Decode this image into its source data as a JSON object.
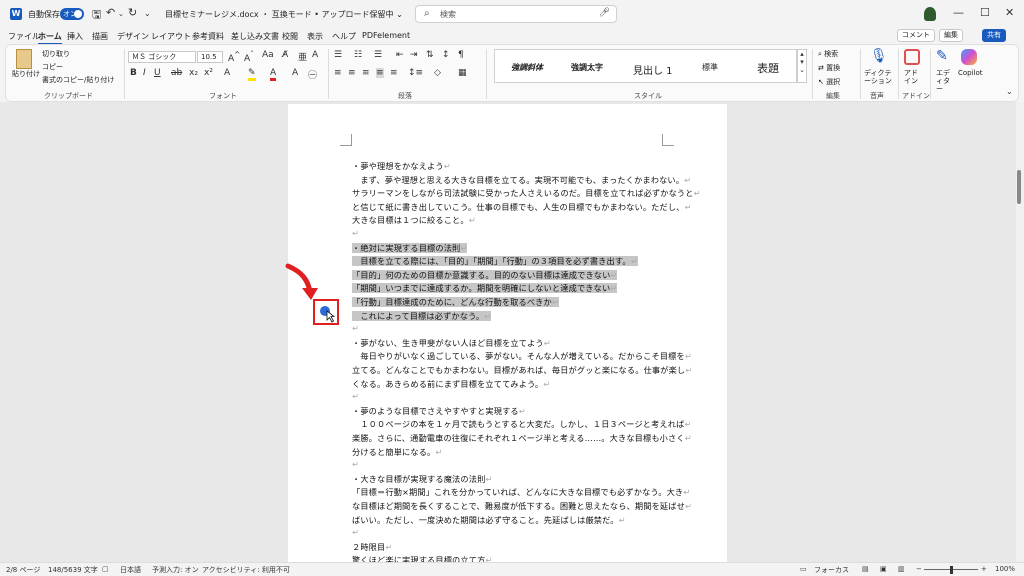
{
  "titlebar": {
    "autosave_label": "自動保存",
    "autosave_toggle": "オン",
    "doc_title": "目標セミナーレジメ.docx ・ 互換モード • アップロード保留中 ⌄",
    "search_placeholder": "検索"
  },
  "menu": [
    "ファイル",
    "ホーム",
    "挿入",
    "描画",
    "デザイン",
    "レイアウト",
    "参考資料",
    "差し込み文書",
    "校閲",
    "表示",
    "ヘルプ",
    "PDFelement"
  ],
  "topbuttons": {
    "comment": "コメント",
    "edit": "編集",
    "share": "共有"
  },
  "ribbon": {
    "clipboard": {
      "paste": "貼り付け",
      "cut": "切り取り",
      "copy": "コピー",
      "format_painter": "書式のコピー/貼り付け",
      "label": "クリップボード"
    },
    "font": {
      "name": "ＭＳ ゴシック",
      "size": "10.5",
      "label": "フォント"
    },
    "paragraph": {
      "label": "段落"
    },
    "styles": {
      "items": [
        "強調斜体",
        "強調太字",
        "見出し 1",
        "標準",
        "表題"
      ],
      "label": "スタイル"
    },
    "editing": {
      "search": "検索",
      "replace": "置換",
      "select": "選択",
      "label": "編集"
    },
    "voice": {
      "dictation": "ディクテーション",
      "label": "音声"
    },
    "addins": {
      "addin": "アドイン",
      "label": "アドイン"
    },
    "editor": "エディター",
    "copilot": "Copilot"
  },
  "document": {
    "lines": [
      {
        "t": "・夢や理想をかなえよう",
        "hl": false
      },
      {
        "t": "　まず、夢や理想と思える大きな目標を立てる。実現不可能でも、まったくかまわない。",
        "hl": false
      },
      {
        "t": "サラリーマンをしながら司法試験に受かった人さえいるのだ。目標を立てれば必ずかなうと",
        "hl": false
      },
      {
        "t": "と信じて紙に書き出していこう。仕事の目標でも、人生の目標でもかまわない。ただし、",
        "hl": false
      },
      {
        "t": "大きな目標は１つに絞ること。",
        "hl": false
      },
      {
        "t": "",
        "hl": false
      },
      {
        "t": "・絶対に実現する目標の法則",
        "hl": true
      },
      {
        "t": "　目標を立てる際には、「目的」「期間」「行動」の３項目を必ず書き出す。",
        "hl": true
      },
      {
        "t": "「目的」何のための目標か意識する。目的のない目標は達成できない",
        "hl": true
      },
      {
        "t": "「期間」いつまでに達成するか。期間を明確にしないと達成できない",
        "hl": true
      },
      {
        "t": "「行動」目標達成のために、どんな行動を取るべきか",
        "hl": true
      },
      {
        "t": "　これによって目標は必ずかなう。",
        "hl": true
      },
      {
        "t": "",
        "hl": false
      },
      {
        "t": "・夢がない、生き甲斐がない人ほど目標を立てよう",
        "hl": false
      },
      {
        "t": "　毎日やりがいなく過ごしている、夢がない。そんな人が増えている。だからこそ目標を",
        "hl": false
      },
      {
        "t": "立てる。どんなことでもかまわない。目標があれば、毎日がグッと楽になる。仕事が楽し",
        "hl": false
      },
      {
        "t": "くなる。あきらめる前にまず目標を立ててみよう。",
        "hl": false
      },
      {
        "t": "",
        "hl": false
      },
      {
        "t": "・夢のような目標でさえやすやすと実現する",
        "hl": false
      },
      {
        "t": "　１００ページの本を１ヶ月で読もうとすると大変だ。しかし、１日３ページと考えれば",
        "hl": false
      },
      {
        "t": "楽勝。さらに、通勤電車の往復にそれぞれ１ページ半と考える……。大きな目標も小さく",
        "hl": false
      },
      {
        "t": "分けると簡単になる。",
        "hl": false
      },
      {
        "t": "",
        "hl": false
      },
      {
        "t": "・大きな目標が実現する魔法の法則",
        "hl": false
      },
      {
        "t": "「目標＝行動×期間」これを分かっていれば、どんなに大きな目標でも必ずかなう。大き",
        "hl": false
      },
      {
        "t": "な目標ほど期間を長くすることで、難易度が低下する。困難と思えたなら、期間を延ばせ",
        "hl": false
      },
      {
        "t": "ばいい。ただし、一度決めた期間は必ず守ること。先延ばしは厳禁だ。",
        "hl": false
      },
      {
        "t": "",
        "hl": false
      },
      {
        "t": "２時限目",
        "hl": false
      },
      {
        "t": "驚くほど楽に実現する目標の立て方",
        "hl": false
      }
    ]
  },
  "status": {
    "page": "2/8 ページ",
    "words": "148/5639 文字",
    "lang": "日本語",
    "predict": "予測入力: オン",
    "access": "アクセシビリティ: 利用不可",
    "focus": "フォーカス",
    "zoom": "100%"
  },
  "colors": {
    "accent": "#185abd",
    "highlight_box": "#e02020",
    "arrow": "#e02020"
  }
}
